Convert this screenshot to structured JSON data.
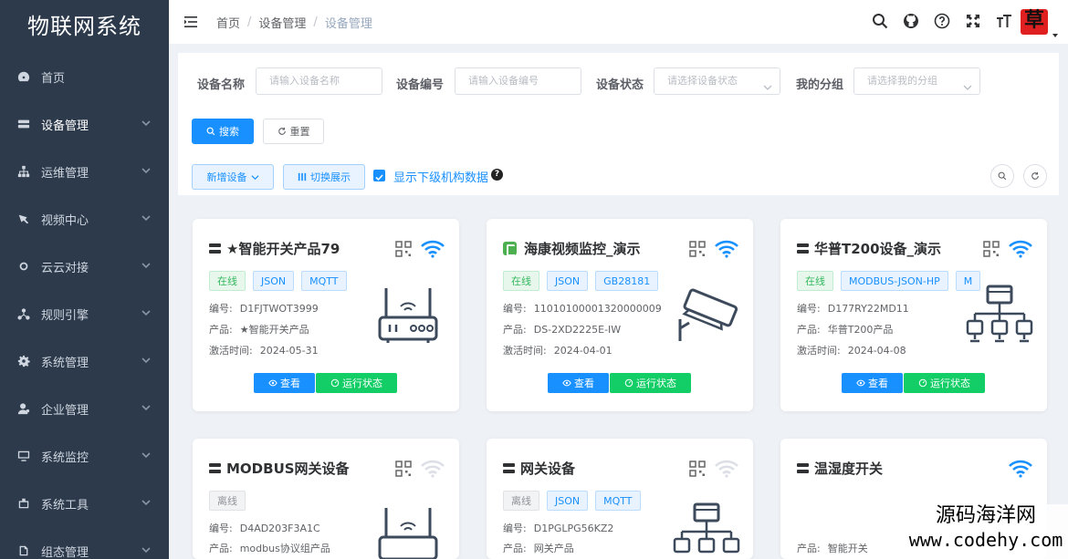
{
  "app": {
    "title": "物联网系统"
  },
  "sidebar": {
    "items": [
      {
        "label": "首页",
        "icon": "dashboard-icon",
        "has_children": false
      },
      {
        "label": "设备管理",
        "icon": "device-icon",
        "has_children": true
      },
      {
        "label": "运维管理",
        "icon": "tree-icon",
        "has_children": true
      },
      {
        "label": "视频中心",
        "icon": "video-icon",
        "has_children": true
      },
      {
        "label": "云云对接",
        "icon": "cloud-icon",
        "has_children": true
      },
      {
        "label": "规则引擎",
        "icon": "rule-icon",
        "has_children": true
      },
      {
        "label": "系统管理",
        "icon": "gear-icon",
        "has_children": true
      },
      {
        "label": "企业管理",
        "icon": "user-icon",
        "has_children": true
      },
      {
        "label": "系统监控",
        "icon": "monitor-icon",
        "has_children": true
      },
      {
        "label": "系统工具",
        "icon": "tool-icon",
        "has_children": true
      },
      {
        "label": "组态管理",
        "icon": "layers-icon",
        "has_children": true
      }
    ]
  },
  "header": {
    "breadcrumbs": [
      "首页",
      "设备管理",
      "设备管理"
    ],
    "separator": "/",
    "tools": [
      "search-icon",
      "github-icon",
      "help-icon",
      "fullscreen-icon",
      "font-size-icon"
    ],
    "avatar_char": "草"
  },
  "filters": {
    "device_name": {
      "label": "设备名称",
      "placeholder": "请输入设备名称"
    },
    "device_code": {
      "label": "设备编号",
      "placeholder": "请输入设备编号"
    },
    "device_status": {
      "label": "设备状态",
      "placeholder": "请选择设备状态"
    },
    "my_group": {
      "label": "我的分组",
      "placeholder": "请选择我的分组"
    },
    "search_label": "搜索",
    "reset_label": "重置"
  },
  "toolbar": {
    "add_label": "新增设备",
    "switch_label": "切换展示",
    "show_sub_label": "显示下级机构数据",
    "show_sub_checked": true
  },
  "labels": {
    "code": "编号:",
    "product": "产品:",
    "activated": "激活时间:",
    "view": "查看",
    "run_status": "运行状态"
  },
  "devices": [
    {
      "name": "★智能开关产品79",
      "tags": [
        {
          "t": "在线",
          "c": "green"
        },
        {
          "t": "JSON",
          "c": "blue"
        },
        {
          "t": "MQTT",
          "c": "blue"
        }
      ],
      "code": "D1FJTWOT3999",
      "product": "★智能开关产品",
      "activated": "2024-05-31",
      "online": true
    },
    {
      "name": "海康视频监控_演示",
      "tags": [
        {
          "t": "在线",
          "c": "green"
        },
        {
          "t": "JSON",
          "c": "blue"
        },
        {
          "t": "GB28181",
          "c": "blue"
        }
      ],
      "code": "11010100001320000009",
      "product": "DS-2XD2225E-IW",
      "activated": "2024-04-01",
      "online": true
    },
    {
      "name": "华普T200设备_演示",
      "tags": [
        {
          "t": "在线",
          "c": "green"
        },
        {
          "t": "MODBUS-JSON-HP",
          "c": "blue"
        },
        {
          "t": "M",
          "c": "blue"
        }
      ],
      "code": "D177RY22MD11",
      "product": "华普T200产品",
      "activated": "2024-04-08",
      "online": true
    },
    {
      "name": "MODBUS网关设备",
      "tags": [
        {
          "t": "离线",
          "c": "gray"
        }
      ],
      "code": "D4AD203F3A1C",
      "product": "modbus协议组产品",
      "online": false
    },
    {
      "name": "网关设备",
      "tags": [
        {
          "t": "离线",
          "c": "gray"
        },
        {
          "t": "JSON",
          "c": "blue"
        },
        {
          "t": "MQTT",
          "c": "blue"
        }
      ],
      "code": "D1PGLPG56KZ2",
      "product": "网关产品",
      "online": false
    },
    {
      "name": "温湿度开关",
      "tags": [],
      "product": "智能开关",
      "online": true
    }
  ],
  "watermark": {
    "line1": "源码海洋网",
    "line2": "www.codehy.com"
  },
  "colors": {
    "primary": "#1890ff",
    "success": "#13ce66",
    "sidebar": "#2c3a4c"
  }
}
